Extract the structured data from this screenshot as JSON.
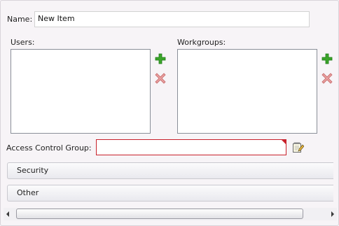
{
  "form": {
    "name_label": "Name:",
    "name_value": "New Item",
    "users_label": "Users:",
    "workgroups_label": "Workgroups:",
    "access_control_group_label": "Access Control Group:",
    "access_control_group_value": ""
  },
  "sections": [
    {
      "label": "Security"
    },
    {
      "label": "Other"
    }
  ],
  "icons": {
    "add": "plus-icon",
    "remove": "x-icon",
    "edit": "notepad-pencil-icon"
  },
  "colors": {
    "add_green": "#3ba52a",
    "remove_red": "#e07c7c",
    "validation_red": "#c8212b"
  }
}
